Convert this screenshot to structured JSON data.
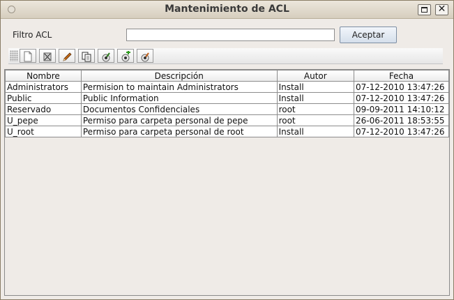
{
  "window": {
    "title": "Mantenimiento de ACL",
    "close_glyph": "✕"
  },
  "filter": {
    "label": "Filtro ACL",
    "value": "",
    "accept_label": "Aceptar"
  },
  "toolbar": {
    "tools": [
      "new-document-icon",
      "delete-icon",
      "edit-pencil-icon",
      "copy-icon",
      "assign-user-icon",
      "add-user-icon",
      "remove-user-icon"
    ]
  },
  "table": {
    "columns": [
      "Nombre",
      "Descripción",
      "Autor",
      "Fecha"
    ],
    "rows": [
      [
        "Administrators",
        "Permision to maintain Administrators",
        "Install",
        "07-12-2010 13:47:26"
      ],
      [
        "Public",
        "Public Information",
        "Install",
        "07-12-2010 13:47:26"
      ],
      [
        "Reservado",
        "Documentos Confidenciales",
        "root",
        "09-09-2011 14:10:12"
      ],
      [
        "U_pepe",
        "Permiso para carpeta personal de pepe",
        "root",
        "26-06-2011 18:53:55"
      ],
      [
        "U_root",
        "Permiso para carpeta personal de root",
        "Install",
        "07-12-2010 13:47:26"
      ]
    ]
  }
}
